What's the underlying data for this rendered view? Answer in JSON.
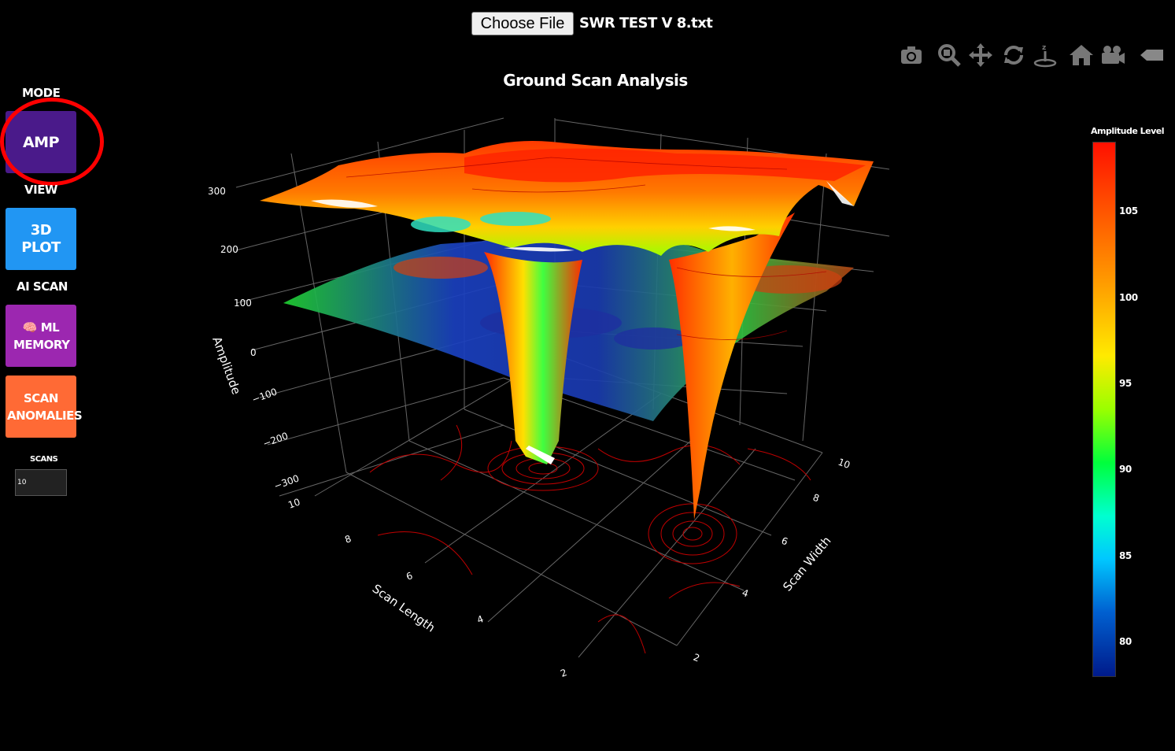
{
  "file": {
    "button_label": "Choose File",
    "file_name": "SWR TEST V 8.txt"
  },
  "modebar": [
    "camera-icon",
    "zoom-icon",
    "pan-icon",
    "orbit-rotation-icon",
    "turntable-rotation-icon",
    "reset-camera-home-icon",
    "reset-last-save-icon",
    "plotly-logo-icon"
  ],
  "title": "Ground Scan Analysis",
  "sidebar": {
    "mode_label": "MODE",
    "amp_label": "AMP",
    "view_label": "VIEW",
    "plot_label": "3D PLOT",
    "ai_label": "AI SCAN",
    "ml_label": "🧠 ML MEMORY",
    "anomalies_label": "SCAN ANOMALIES",
    "scans_label": "SCANS",
    "scans_value": "10"
  },
  "colors": {
    "amp": "#4a1a8a",
    "plot": "#2196f3",
    "ml": "#9c27b0",
    "anomalies": "#ff6a35",
    "highlight": "#ff0000"
  },
  "chart_data": {
    "type": "surface3d",
    "title": "Ground Scan Analysis",
    "axes": {
      "z": {
        "label": "Amplitude",
        "ticks": [
          "300",
          "200",
          "100",
          "0",
          "−100",
          "−200",
          "−300"
        ]
      },
      "x": {
        "label": "Scan Length",
        "ticks": [
          "10",
          "8",
          "6",
          "4",
          "2"
        ]
      },
      "y": {
        "label": "Scan Width",
        "ticks": [
          "10",
          "8",
          "6",
          "4",
          "2"
        ]
      }
    },
    "surfaces": [
      {
        "name": "upper",
        "approx_level": 270
      },
      {
        "name": "lower",
        "approx_level": 50
      }
    ],
    "anomalies": [
      {
        "approx_scan_length": 5,
        "approx_scan_width": 8,
        "depth": -300
      },
      {
        "approx_scan_length": 3,
        "approx_scan_width": 5,
        "depth": -300
      }
    ],
    "colorbar": {
      "title": "Amplitude Level",
      "ticks": [
        "105",
        "100",
        "95",
        "90",
        "85",
        "80"
      ],
      "range": [
        78,
        108
      ]
    }
  }
}
